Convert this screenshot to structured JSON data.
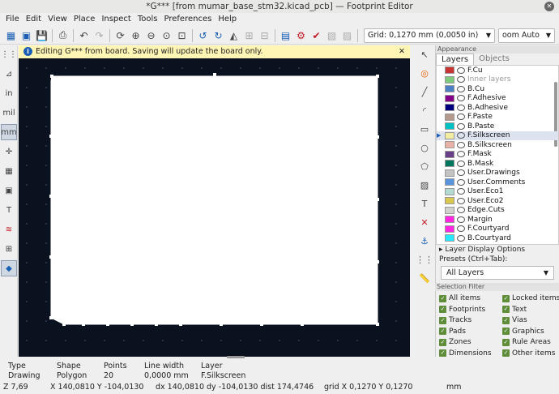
{
  "window": {
    "title": "*G*** [from mumar_base_stm32.kicad_pcb] — Footprint Editor"
  },
  "menu": [
    "File",
    "Edit",
    "View",
    "Place",
    "Inspect",
    "Tools",
    "Preferences",
    "Help"
  ],
  "toolbar": {
    "grid_label": "Grid: 0,1270 mm (0,0050 in)",
    "zoom_label": "oom Auto"
  },
  "infobar": {
    "message": "Editing G*** from board.  Saving will update the board only."
  },
  "left_tools": [
    {
      "name": "grid-icon",
      "text": "⋮⋮"
    },
    {
      "name": "polar-coords-icon",
      "text": "⊿"
    },
    {
      "name": "inches-icon",
      "text": "in"
    },
    {
      "name": "mils-icon",
      "text": "mil"
    },
    {
      "name": "millimeters-icon",
      "text": "mm"
    },
    {
      "name": "cursor-shape-icon",
      "text": "✛"
    },
    {
      "name": "pad-outline-icon",
      "text": "▦"
    },
    {
      "name": "via-outline-icon",
      "text": "▣"
    },
    {
      "name": "graphic-outline-icon",
      "text": "T"
    },
    {
      "name": "high-contrast-icon",
      "text": "≋"
    },
    {
      "name": "tree-icon",
      "text": "⊞"
    },
    {
      "name": "layers-manager-icon",
      "text": "◆"
    }
  ],
  "right_tools": [
    {
      "name": "select-icon",
      "text": "↖"
    },
    {
      "name": "pad-tool-icon",
      "text": "◎"
    },
    {
      "name": "line-tool-icon",
      "text": "╱"
    },
    {
      "name": "arc-tool-icon",
      "text": "◜"
    },
    {
      "name": "rect-tool-icon",
      "text": "▭"
    },
    {
      "name": "circle-tool-icon",
      "text": "○"
    },
    {
      "name": "polygon-tool-icon",
      "text": "⬠"
    },
    {
      "name": "zone-tool-icon",
      "text": "▨"
    },
    {
      "name": "text-tool-icon",
      "text": "T"
    },
    {
      "name": "delete-tool-icon",
      "text": "✕"
    },
    {
      "name": "anchor-icon",
      "text": "⚓"
    },
    {
      "name": "grid-origin-icon",
      "text": "⋮⋮"
    },
    {
      "name": "measure-icon",
      "text": "📏"
    }
  ],
  "appearance": {
    "header": "Appearance",
    "tab_layers": "Layers",
    "tab_objects": "Objects",
    "layers": [
      {
        "name": "F.Cu",
        "color": "#c83434"
      },
      {
        "name": "Inner layers",
        "color": "#7fc97f",
        "dim": true
      },
      {
        "name": "B.Cu",
        "color": "#4d7fc4"
      },
      {
        "name": "F.Adhesive",
        "color": "#84008a"
      },
      {
        "name": "B.Adhesive",
        "color": "#00007f"
      },
      {
        "name": "F.Paste",
        "color": "#b49a8c"
      },
      {
        "name": "B.Paste",
        "color": "#00c2c2"
      },
      {
        "name": "F.Silkscreen",
        "color": "#f2eda1",
        "selected": true
      },
      {
        "name": "B.Silkscreen",
        "color": "#e8b2a7"
      },
      {
        "name": "F.Mask",
        "color": "#6a3f8a"
      },
      {
        "name": "B.Mask",
        "color": "#02775f"
      },
      {
        "name": "User.Drawings",
        "color": "#c2c2c2"
      },
      {
        "name": "User.Comments",
        "color": "#5994dc"
      },
      {
        "name": "User.Eco1",
        "color": "#b4dbd2"
      },
      {
        "name": "User.Eco2",
        "color": "#d8c852"
      },
      {
        "name": "Edge.Cuts",
        "color": "#d0d2cd"
      },
      {
        "name": "Margin",
        "color": "#ff26e2"
      },
      {
        "name": "F.Courtyard",
        "color": "#ff26e2"
      },
      {
        "name": "B.Courtyard",
        "color": "#26e9ff"
      }
    ],
    "layer_display_options": "Layer Display Options",
    "presets_label": "Presets (Ctrl+Tab):",
    "presets_value": "All Layers"
  },
  "selection_filter": {
    "header": "Selection Filter",
    "items": [
      "All items",
      "Locked items",
      "Footprints",
      "Text",
      "Tracks",
      "Vias",
      "Pads",
      "Graphics",
      "Zones",
      "Rule Areas",
      "Dimensions",
      "Other items"
    ]
  },
  "status": {
    "headers": [
      "Type",
      "Shape",
      "Points",
      "Line width",
      "Layer"
    ],
    "values": [
      "Drawing",
      "Polygon",
      "20",
      "0,0000 mm",
      "F.Silkscreen"
    ],
    "zoom": "Z 7,69",
    "coords": "X 140,0810  Y -104,0130",
    "delta": "dx 140,0810  dy -104,0130  dist 174,4746",
    "grid": "grid X 0,1270  Y 0,1270",
    "units": "mm"
  },
  "colors": {
    "canvas_bg": "#0a1220",
    "info_bg": "#fff5b5",
    "accent": "#1a5fb4"
  }
}
